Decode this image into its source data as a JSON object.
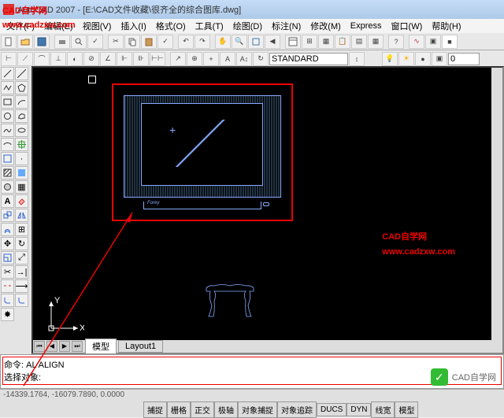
{
  "title": "AutoCAD 2007 - [E:\\CAD文件收藏\\很齐全的综合图库.dwg]",
  "menus": [
    "文件(F)",
    "编辑(E)",
    "视图(V)",
    "插入(I)",
    "格式(O)",
    "工具(T)",
    "绘图(D)",
    "标注(N)",
    "修改(M)",
    "Express",
    "窗口(W)",
    "帮助(H)"
  ],
  "toolbar2": {
    "style": "STANDARD"
  },
  "layerbox": "0",
  "tabs": {
    "model": "模型",
    "layout": "Layout1"
  },
  "cmd": {
    "line1": "命令: AL ALIGN",
    "line2": "选择对象:"
  },
  "coords": "-14339.1764, -16079.7890, 0.0000",
  "status": [
    "捕捉",
    "栅格",
    "正交",
    "极轴",
    "对象捕捉",
    "对象追踪",
    "DUCS",
    "DYN",
    "线宽",
    "模型"
  ],
  "ucs": {
    "x": "X",
    "y": "Y"
  },
  "watermark": {
    "name": "CAD自学网",
    "url": "www.cadzxw.com"
  },
  "credit": "CAD自学网",
  "tv_brand": "Forey"
}
